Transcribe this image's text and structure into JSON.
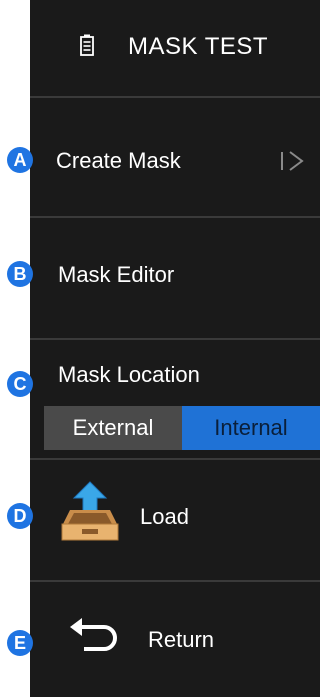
{
  "menu": {
    "title": "MASK TEST",
    "items": [
      {
        "badge": "A",
        "label": "Create Mask",
        "icon": "submenu-arrow-icon"
      },
      {
        "badge": "B",
        "label": "Mask Editor"
      },
      {
        "badge": "C",
        "label": "Mask Location",
        "options": [
          "External",
          "Internal"
        ],
        "selected": "Internal"
      },
      {
        "badge": "D",
        "label": "Load",
        "icon": "load-tray-icon"
      },
      {
        "badge": "E",
        "label": "Return",
        "icon": "return-arrow-icon"
      }
    ]
  },
  "colors": {
    "panel_bg": "#1a1a1a",
    "divider": "#3a3a3a",
    "badge": "#1f74e2",
    "selected_option": "#1f72d6",
    "unselected_option": "#4a4a4a"
  }
}
